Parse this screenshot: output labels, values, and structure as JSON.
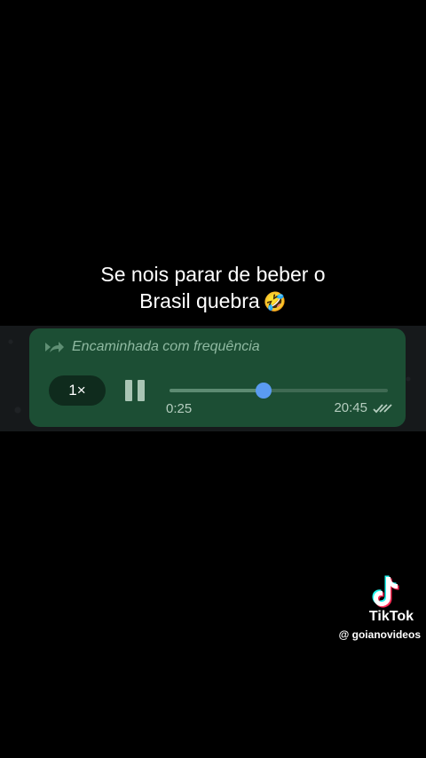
{
  "caption": {
    "line1": "Se nois parar de beber o",
    "line2": "Brasil quebra",
    "emoji": "🤣"
  },
  "voice_message": {
    "forwarded_label": "Encaminhada com frequência",
    "speed_label": "1×",
    "elapsed": "0:25",
    "timestamp": "20:45",
    "progress_fraction": 0.43,
    "bubble_color": "#1c4e34",
    "knob_color": "#5a9bf0",
    "read_status_icon": "double-check-icon",
    "play_state_icon": "pause-icon"
  },
  "watermark": {
    "brand": "TikTok",
    "handle": "@ goianovideos"
  }
}
